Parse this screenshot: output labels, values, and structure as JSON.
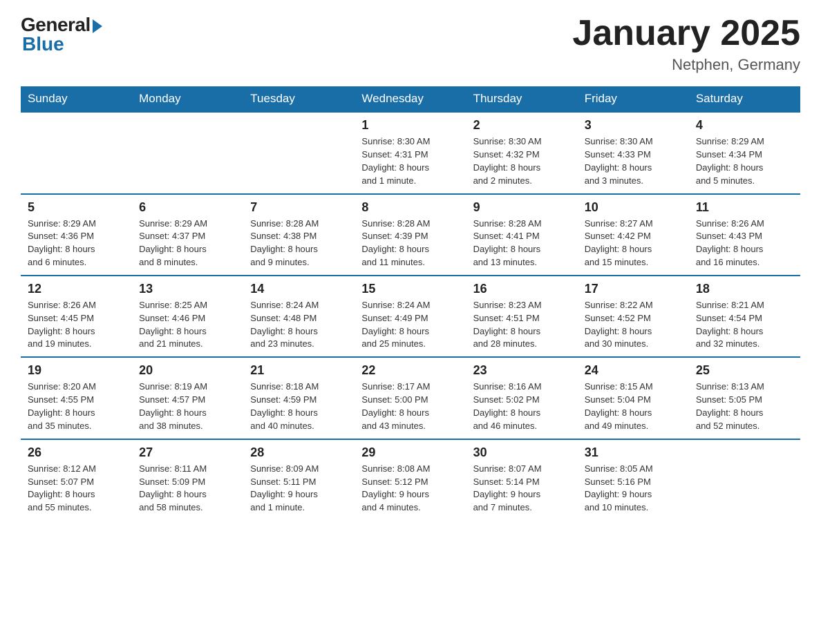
{
  "header": {
    "logo_general": "General",
    "logo_blue": "Blue",
    "month_title": "January 2025",
    "location": "Netphen, Germany"
  },
  "weekdays": [
    "Sunday",
    "Monday",
    "Tuesday",
    "Wednesday",
    "Thursday",
    "Friday",
    "Saturday"
  ],
  "weeks": [
    [
      {
        "day": "",
        "info": ""
      },
      {
        "day": "",
        "info": ""
      },
      {
        "day": "",
        "info": ""
      },
      {
        "day": "1",
        "info": "Sunrise: 8:30 AM\nSunset: 4:31 PM\nDaylight: 8 hours\nand 1 minute."
      },
      {
        "day": "2",
        "info": "Sunrise: 8:30 AM\nSunset: 4:32 PM\nDaylight: 8 hours\nand 2 minutes."
      },
      {
        "day": "3",
        "info": "Sunrise: 8:30 AM\nSunset: 4:33 PM\nDaylight: 8 hours\nand 3 minutes."
      },
      {
        "day": "4",
        "info": "Sunrise: 8:29 AM\nSunset: 4:34 PM\nDaylight: 8 hours\nand 5 minutes."
      }
    ],
    [
      {
        "day": "5",
        "info": "Sunrise: 8:29 AM\nSunset: 4:36 PM\nDaylight: 8 hours\nand 6 minutes."
      },
      {
        "day": "6",
        "info": "Sunrise: 8:29 AM\nSunset: 4:37 PM\nDaylight: 8 hours\nand 8 minutes."
      },
      {
        "day": "7",
        "info": "Sunrise: 8:28 AM\nSunset: 4:38 PM\nDaylight: 8 hours\nand 9 minutes."
      },
      {
        "day": "8",
        "info": "Sunrise: 8:28 AM\nSunset: 4:39 PM\nDaylight: 8 hours\nand 11 minutes."
      },
      {
        "day": "9",
        "info": "Sunrise: 8:28 AM\nSunset: 4:41 PM\nDaylight: 8 hours\nand 13 minutes."
      },
      {
        "day": "10",
        "info": "Sunrise: 8:27 AM\nSunset: 4:42 PM\nDaylight: 8 hours\nand 15 minutes."
      },
      {
        "day": "11",
        "info": "Sunrise: 8:26 AM\nSunset: 4:43 PM\nDaylight: 8 hours\nand 16 minutes."
      }
    ],
    [
      {
        "day": "12",
        "info": "Sunrise: 8:26 AM\nSunset: 4:45 PM\nDaylight: 8 hours\nand 19 minutes."
      },
      {
        "day": "13",
        "info": "Sunrise: 8:25 AM\nSunset: 4:46 PM\nDaylight: 8 hours\nand 21 minutes."
      },
      {
        "day": "14",
        "info": "Sunrise: 8:24 AM\nSunset: 4:48 PM\nDaylight: 8 hours\nand 23 minutes."
      },
      {
        "day": "15",
        "info": "Sunrise: 8:24 AM\nSunset: 4:49 PM\nDaylight: 8 hours\nand 25 minutes."
      },
      {
        "day": "16",
        "info": "Sunrise: 8:23 AM\nSunset: 4:51 PM\nDaylight: 8 hours\nand 28 minutes."
      },
      {
        "day": "17",
        "info": "Sunrise: 8:22 AM\nSunset: 4:52 PM\nDaylight: 8 hours\nand 30 minutes."
      },
      {
        "day": "18",
        "info": "Sunrise: 8:21 AM\nSunset: 4:54 PM\nDaylight: 8 hours\nand 32 minutes."
      }
    ],
    [
      {
        "day": "19",
        "info": "Sunrise: 8:20 AM\nSunset: 4:55 PM\nDaylight: 8 hours\nand 35 minutes."
      },
      {
        "day": "20",
        "info": "Sunrise: 8:19 AM\nSunset: 4:57 PM\nDaylight: 8 hours\nand 38 minutes."
      },
      {
        "day": "21",
        "info": "Sunrise: 8:18 AM\nSunset: 4:59 PM\nDaylight: 8 hours\nand 40 minutes."
      },
      {
        "day": "22",
        "info": "Sunrise: 8:17 AM\nSunset: 5:00 PM\nDaylight: 8 hours\nand 43 minutes."
      },
      {
        "day": "23",
        "info": "Sunrise: 8:16 AM\nSunset: 5:02 PM\nDaylight: 8 hours\nand 46 minutes."
      },
      {
        "day": "24",
        "info": "Sunrise: 8:15 AM\nSunset: 5:04 PM\nDaylight: 8 hours\nand 49 minutes."
      },
      {
        "day": "25",
        "info": "Sunrise: 8:13 AM\nSunset: 5:05 PM\nDaylight: 8 hours\nand 52 minutes."
      }
    ],
    [
      {
        "day": "26",
        "info": "Sunrise: 8:12 AM\nSunset: 5:07 PM\nDaylight: 8 hours\nand 55 minutes."
      },
      {
        "day": "27",
        "info": "Sunrise: 8:11 AM\nSunset: 5:09 PM\nDaylight: 8 hours\nand 58 minutes."
      },
      {
        "day": "28",
        "info": "Sunrise: 8:09 AM\nSunset: 5:11 PM\nDaylight: 9 hours\nand 1 minute."
      },
      {
        "day": "29",
        "info": "Sunrise: 8:08 AM\nSunset: 5:12 PM\nDaylight: 9 hours\nand 4 minutes."
      },
      {
        "day": "30",
        "info": "Sunrise: 8:07 AM\nSunset: 5:14 PM\nDaylight: 9 hours\nand 7 minutes."
      },
      {
        "day": "31",
        "info": "Sunrise: 8:05 AM\nSunset: 5:16 PM\nDaylight: 9 hours\nand 10 minutes."
      },
      {
        "day": "",
        "info": ""
      }
    ]
  ]
}
